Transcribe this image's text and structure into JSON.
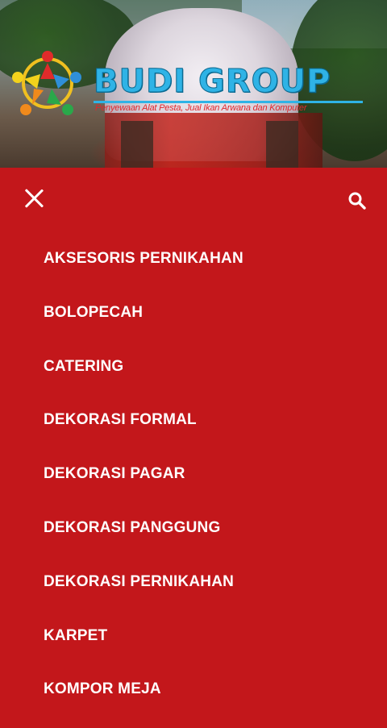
{
  "header": {
    "brand_title": "BUDI GROUP",
    "tagline": "Penyewaan Alat Pesta, Jual Ikan Arwana dan Komputer"
  },
  "menu": {
    "close_icon": "close-icon",
    "search_icon": "search-icon",
    "items": [
      {
        "label": "AKSESORIS PERNIKAHAN"
      },
      {
        "label": "BOLOPECAH"
      },
      {
        "label": "CATERING"
      },
      {
        "label": "DEKORASI FORMAL"
      },
      {
        "label": "DEKORASI PAGAR"
      },
      {
        "label": "DEKORASI PANGGUNG"
      },
      {
        "label": "DEKORASI PERNIKAHAN"
      },
      {
        "label": "KARPET"
      },
      {
        "label": "KOMPOR MEJA"
      }
    ]
  },
  "colors": {
    "menu_background": "#c3171b",
    "menu_text": "#ffffff",
    "brand_blue": "#2fb3e6",
    "tagline_red": "#e3262b"
  }
}
